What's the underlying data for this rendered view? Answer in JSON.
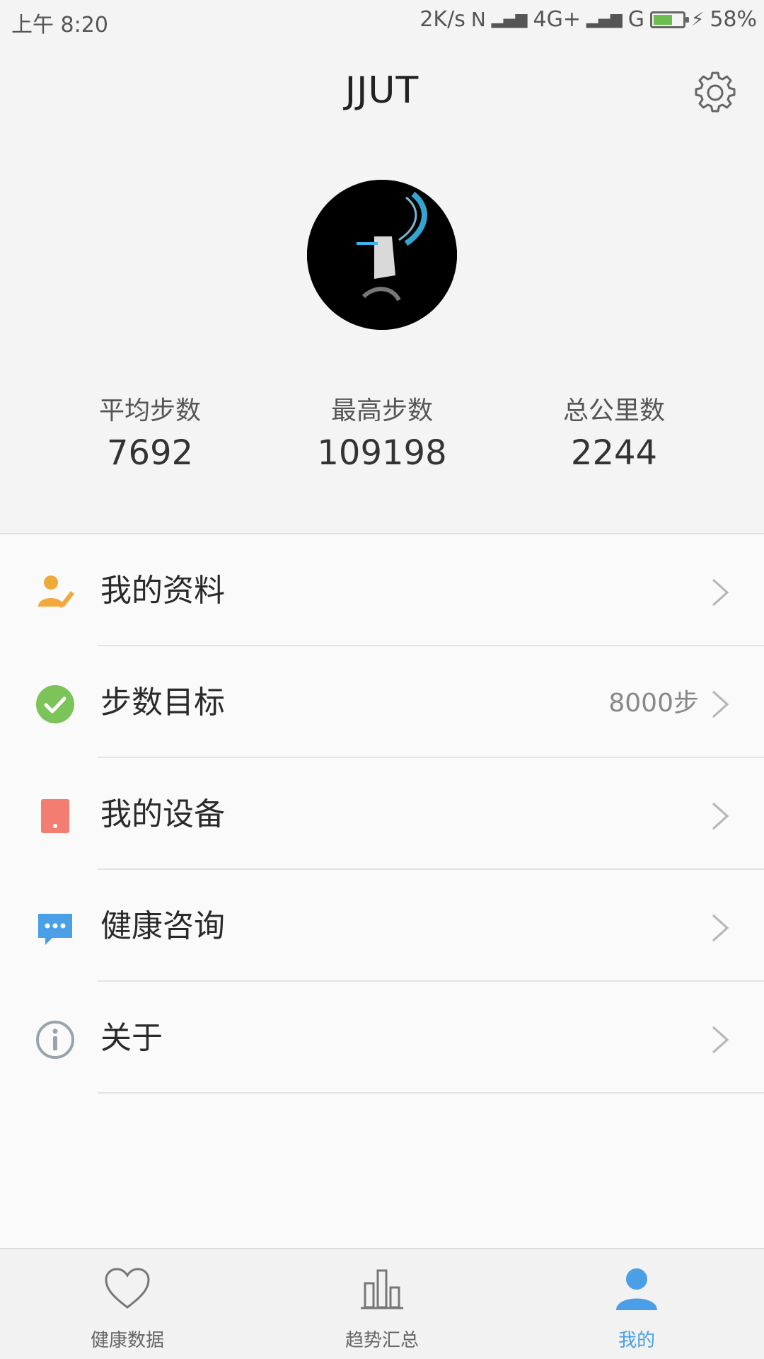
{
  "status_bar": {
    "time": "上午 8:20",
    "net_speed": "2K/s",
    "signal_1": "4G+",
    "signal_2": "G",
    "battery": "58%",
    "battery_level": 0.58
  },
  "header": {
    "title": "JJUT",
    "settings_icon": "gear-icon"
  },
  "stats": [
    {
      "label": "平均步数",
      "value": "7692"
    },
    {
      "label": "最高步数",
      "value": "109198"
    },
    {
      "label": "总公里数",
      "value": "2244"
    }
  ],
  "menu": [
    {
      "label": "我的资料",
      "value": "",
      "icon": "profile-edit-icon",
      "color": "#f2a93b"
    },
    {
      "label": "步数目标",
      "value": "8000步",
      "icon": "check-circle-icon",
      "color": "#7cc35a"
    },
    {
      "label": "我的设备",
      "value": "",
      "icon": "device-icon",
      "color": "#f47d72"
    },
    {
      "label": "健康咨询",
      "value": "",
      "icon": "chat-icon",
      "color": "#4a9fe6"
    },
    {
      "label": "关于",
      "value": "",
      "icon": "info-icon",
      "color": "#9aa3ad"
    }
  ],
  "bottom_nav": [
    {
      "label": "健康数据",
      "icon": "heart-icon",
      "active": false
    },
    {
      "label": "趋势汇总",
      "icon": "bar-chart-icon",
      "active": false
    },
    {
      "label": "我的",
      "icon": "person-icon",
      "active": true
    }
  ],
  "colors": {
    "accent": "#4a9fe6",
    "background": "#f4f4f4"
  }
}
